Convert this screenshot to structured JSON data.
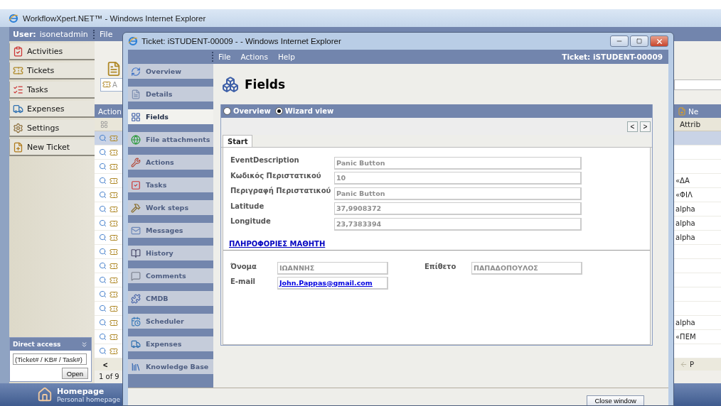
{
  "main_window": {
    "title": "WorkflowXpert.NET™ - Windows Internet Explorer",
    "user_label": "User:",
    "user_name": "isonetadmin",
    "menu": [
      "File"
    ],
    "sidebar": [
      {
        "label": "Activities"
      },
      {
        "label": "Tickets"
      },
      {
        "label": "Tasks"
      },
      {
        "label": "Expenses"
      },
      {
        "label": "Settings"
      },
      {
        "label": "New Ticket"
      }
    ],
    "direct_access": {
      "title": "Direct access",
      "placeholder": "(Ticket# / KB# / Task#)",
      "button": "Open"
    },
    "homepage": {
      "title": "Homepage",
      "subtitle": "Personal homepage"
    },
    "content": {
      "search_text": "A",
      "actions_header": "Action",
      "new_button": "Ne",
      "attrib_header": "Attrib",
      "prev_label": "P",
      "pagination": "1 of 9",
      "prev_page": "<",
      "rows": [
        {
          "selected": true
        },
        {
          "selected": false
        },
        {
          "selected": false
        },
        {
          "selected": false,
          "attrib": "«ΔΑ"
        },
        {
          "selected": false,
          "attrib": "«ΦΙΛ"
        },
        {
          "selected": false,
          "attrib": "alpha"
        },
        {
          "selected": false,
          "attrib": "alpha"
        },
        {
          "selected": false,
          "attrib": "alpha"
        },
        {
          "selected": false
        },
        {
          "selected": false
        },
        {
          "selected": false
        },
        {
          "selected": false
        },
        {
          "selected": false
        },
        {
          "selected": false,
          "attrib": "alpha"
        },
        {
          "selected": false,
          "attrib": "«ΠΕΜ"
        },
        {
          "selected": false
        }
      ]
    }
  },
  "ticket_window": {
    "title": "Ticket: iSTUDENT-00009 - - Windows Internet Explorer",
    "menu": [
      "File",
      "Actions",
      "Help"
    ],
    "ticket_label": "Ticket: iSTUDENT-00009",
    "nav": [
      {
        "label": "Overview",
        "selected": false
      },
      {
        "label": "Details",
        "selected": false
      },
      {
        "label": "Fields",
        "selected": true
      },
      {
        "label": "File attachments",
        "selected": false
      },
      {
        "label": "Actions",
        "selected": false
      },
      {
        "label": "Tasks",
        "selected": false
      },
      {
        "label": "Work steps",
        "selected": false
      },
      {
        "label": "Messages",
        "selected": false
      },
      {
        "label": "History",
        "selected": false
      },
      {
        "label": "Comments",
        "selected": false
      },
      {
        "label": "CMDB",
        "selected": false
      },
      {
        "label": "Scheduler",
        "selected": false
      },
      {
        "label": "Expenses",
        "selected": false
      },
      {
        "label": "Knowledge Base",
        "selected": false
      }
    ],
    "heading": "Fields",
    "view_options": [
      {
        "label": "Overview",
        "selected": false
      },
      {
        "label": "Wizard view",
        "selected": true
      }
    ],
    "prev": "<",
    "next": ">",
    "tabs": [
      {
        "label": "Start",
        "selected": true
      }
    ],
    "fields": [
      {
        "label": "EventDescription",
        "value": "Panic Button",
        "disabled": true
      },
      {
        "label": "Κωδικός Περιστατικού",
        "value": "10",
        "disabled": true
      },
      {
        "label": "Περιγραφή Περιστατικού",
        "value": "Panic Button",
        "disabled": true
      },
      {
        "label": "Latitude",
        "value": "37,9908372",
        "disabled": true
      },
      {
        "label": "Longitude",
        "value": "23,7383394",
        "disabled": true
      }
    ],
    "section": {
      "title": "ΠΛΗΡΟΦΟΡΙΕΣ ΜΑΘΗΤΗ",
      "fields": [
        {
          "label": "Όνομα",
          "value": "ΙΩΑΝΝΗΣ",
          "kind": "text",
          "disabled": true
        },
        {
          "label": "Επίθετο",
          "value": "ΠΑΠΑΔΟΠΟΥΛΟΣ",
          "kind": "text",
          "disabled": true
        },
        {
          "label": "E-mail",
          "value": "John.Pappas@gmail.com",
          "kind": "link"
        }
      ]
    },
    "close_button": "Close window"
  }
}
